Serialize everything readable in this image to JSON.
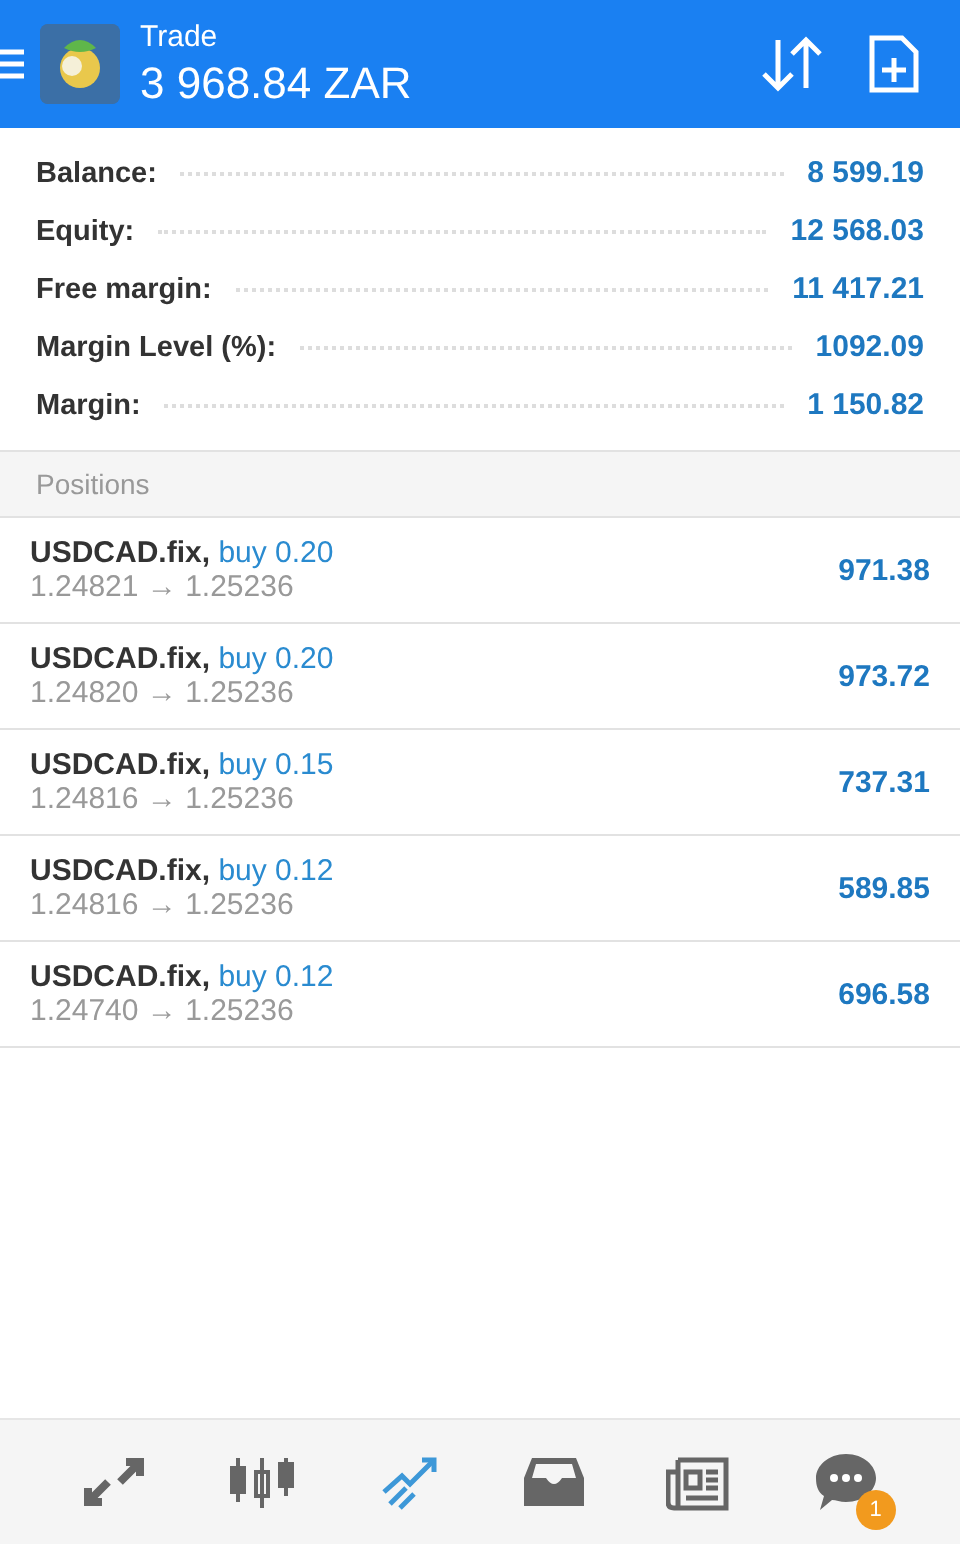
{
  "header": {
    "title": "Trade",
    "balance": "3 968.84 ZAR"
  },
  "summary": [
    {
      "label": "Balance:",
      "value": "8 599.19"
    },
    {
      "label": "Equity:",
      "value": "12 568.03"
    },
    {
      "label": "Free margin:",
      "value": "11 417.21"
    },
    {
      "label": "Margin Level (%):",
      "value": "1092.09"
    },
    {
      "label": "Margin:",
      "value": "1 150.82"
    }
  ],
  "positions": {
    "title": "Positions",
    "rows": [
      {
        "symbol": "USDCAD.fix,",
        "side": "buy 0.20",
        "open": "1.24821",
        "arrow": "→",
        "current": "1.25236",
        "profit": "971.38"
      },
      {
        "symbol": "USDCAD.fix,",
        "side": "buy 0.20",
        "open": "1.24820",
        "arrow": "→",
        "current": "1.25236",
        "profit": "973.72"
      },
      {
        "symbol": "USDCAD.fix,",
        "side": "buy 0.15",
        "open": "1.24816",
        "arrow": "→",
        "current": "1.25236",
        "profit": "737.31"
      },
      {
        "symbol": "USDCAD.fix,",
        "side": "buy 0.12",
        "open": "1.24816",
        "arrow": "→",
        "current": "1.25236",
        "profit": "589.85"
      },
      {
        "symbol": "USDCAD.fix,",
        "side": "buy 0.12",
        "open": "1.24740",
        "arrow": "→",
        "current": "1.25236",
        "profit": "696.58"
      }
    ]
  },
  "nav": [
    {
      "kind": "quotes",
      "selected": false
    },
    {
      "kind": "chart",
      "selected": false
    },
    {
      "kind": "trade",
      "selected": true
    },
    {
      "kind": "inbox",
      "selected": false
    },
    {
      "kind": "news",
      "selected": false
    },
    {
      "kind": "chat",
      "selected": false,
      "badge": "1"
    }
  ]
}
